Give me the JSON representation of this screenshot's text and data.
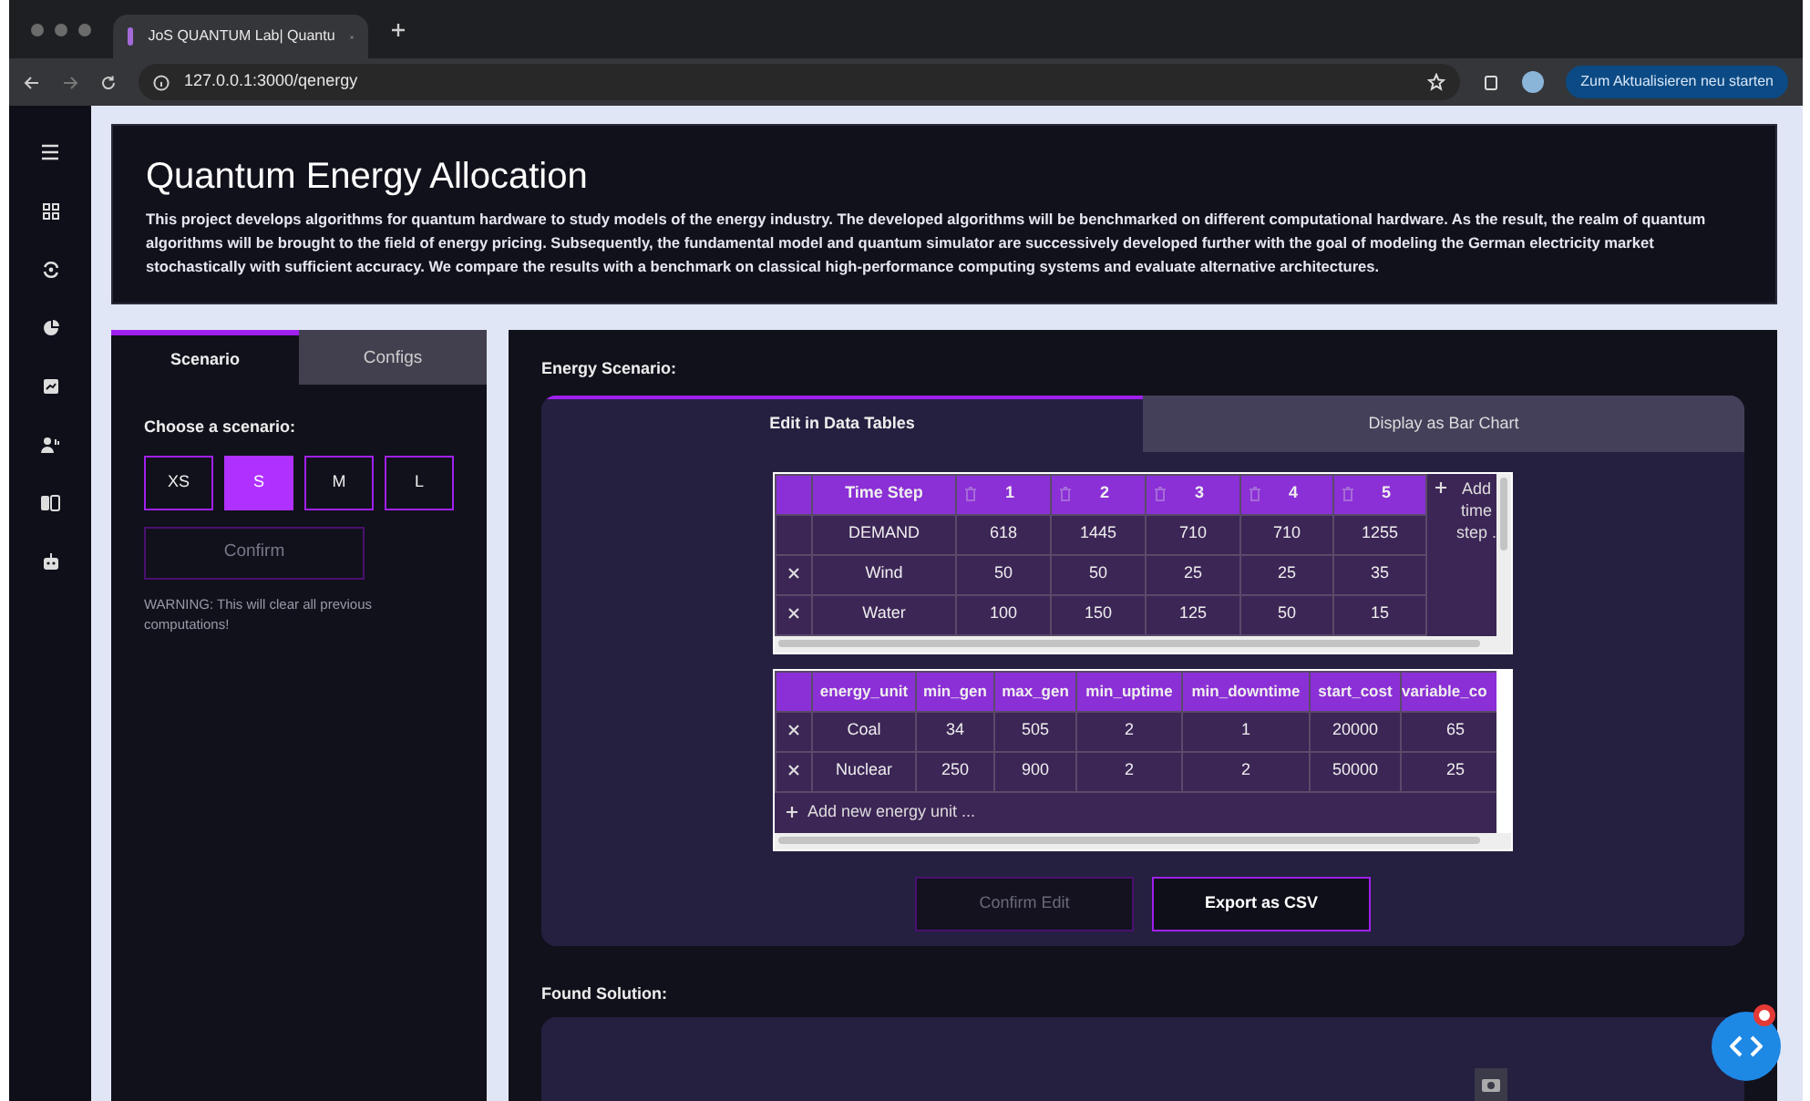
{
  "browser": {
    "tab_title": "JoS QUANTUM Lab| Quantu",
    "url": "127.0.0.1:3000/qenergy",
    "update_button": "Zum Aktualisieren neu starten"
  },
  "header": {
    "title": "Quantum Energy Allocation",
    "description": "This project develops algorithms for quantum hardware to study models of the energy industry. The developed algorithms will be benchmarked on different computational hardware. As the result, the realm of quantum algorithms will be brought to the field of energy pricing. Subsequently, the fundamental model and quantum simulator are successively developed further with the goal of modeling the German electricity market stochastically with sufficient accuracy. We compare the results with a benchmark on classical high-performance computing systems and evaluate alternative architectures."
  },
  "left_panel": {
    "tabs": [
      {
        "label": "Scenario",
        "selected": true
      },
      {
        "label": "Configs",
        "selected": false
      }
    ],
    "prompt": "Choose a scenario:",
    "scenarios": [
      {
        "label": "XS",
        "selected": false
      },
      {
        "label": "S",
        "selected": true
      },
      {
        "label": "M",
        "selected": false
      },
      {
        "label": "L",
        "selected": false
      }
    ],
    "confirm_button": {
      "label": "Confirm",
      "disabled": true
    },
    "warning": "WARNING: This will clear all previous computations!"
  },
  "energy_scenario": {
    "title": "Energy Scenario:",
    "tabs": [
      {
        "label": "Edit in Data Tables",
        "selected": true
      },
      {
        "label": "Display as Bar Chart",
        "selected": false
      }
    ],
    "time_table": {
      "columns": [
        "Time Step",
        "1",
        "2",
        "3",
        "4",
        "5"
      ],
      "add_column": "Add time step .",
      "rows": [
        {
          "deletable": false,
          "cells": [
            "DEMAND",
            "618",
            "1445",
            "710",
            "710",
            "1255"
          ]
        },
        {
          "deletable": true,
          "cells": [
            "Wind",
            "50",
            "50",
            "25",
            "25",
            "35"
          ]
        },
        {
          "deletable": true,
          "cells": [
            "Water",
            "100",
            "150",
            "125",
            "50",
            "15"
          ]
        }
      ]
    },
    "units_table": {
      "columns": [
        "energy_unit",
        "min_gen",
        "max_gen",
        "min_uptime",
        "min_downtime",
        "start_cost",
        "variable_co"
      ],
      "add_row": "Add new energy unit ...",
      "rows": [
        {
          "deletable": true,
          "cells": [
            "Coal",
            "34",
            "505",
            "2",
            "1",
            "20000",
            "65"
          ]
        },
        {
          "deletable": true,
          "cells": [
            "Nuclear",
            "250",
            "900",
            "2",
            "2",
            "50000",
            "25"
          ]
        }
      ]
    },
    "buttons": [
      {
        "label": "Confirm Edit",
        "disabled": true
      },
      {
        "label": "Export as CSV",
        "disabled": false
      }
    ]
  },
  "solution": {
    "title": "Found Solution:"
  }
}
